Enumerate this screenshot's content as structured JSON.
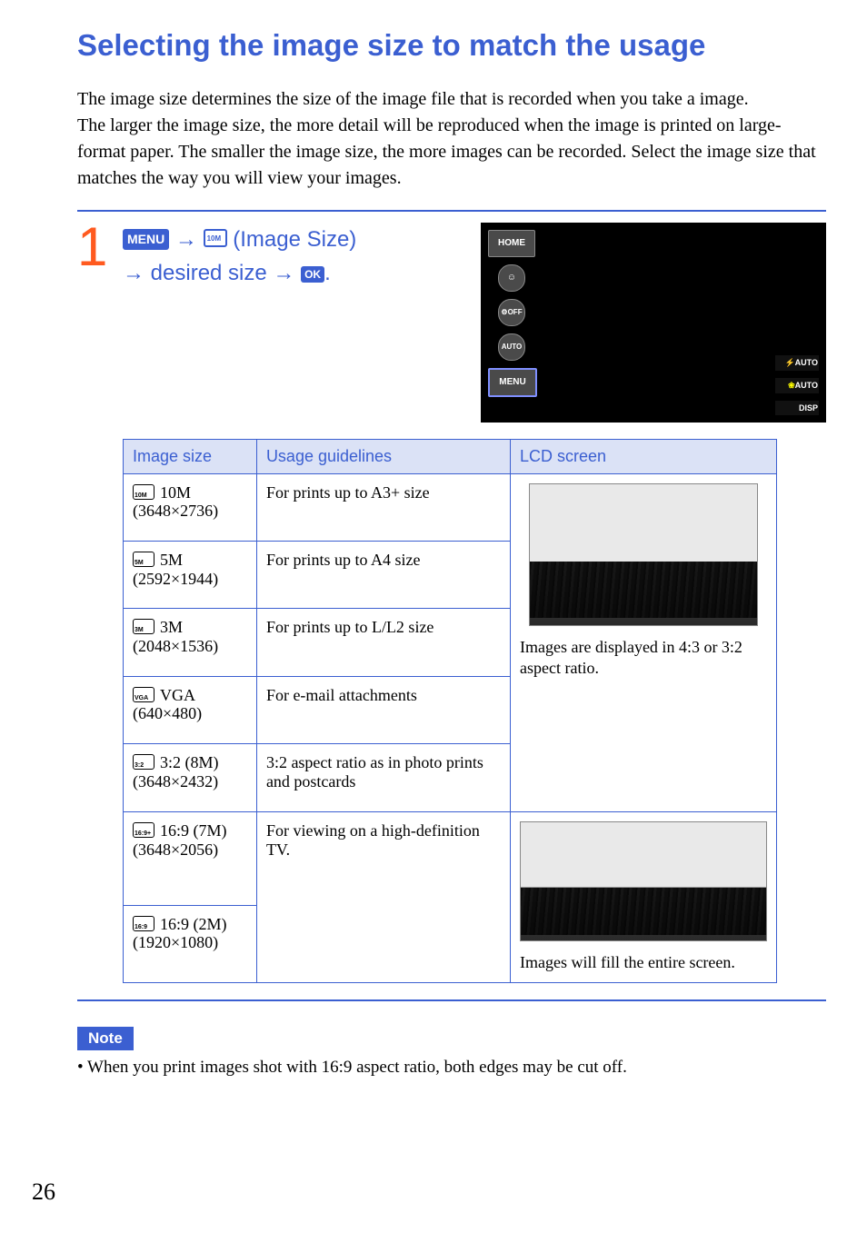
{
  "page": {
    "title": "Selecting the image size to match the usage",
    "intro": "The image size determines the size of the image file that is recorded when you take a image.\nThe larger the image size, the more detail will be reproduced when the image is printed on large-format paper. The smaller the image size, the more images can be recorded. Select the image size that matches the way you will view your images.",
    "page_number": "26"
  },
  "step": {
    "number": "1",
    "menu_label": "MENU",
    "image_size_label": "(Image Size)",
    "desired_label": "desired size",
    "ok_label": "OK",
    "period": "."
  },
  "camera": {
    "left": [
      "HOME",
      "☺",
      "⚙OFF",
      "AUTO",
      "MENU"
    ],
    "right": [
      {
        "lead": "⚡",
        "text": "AUTO"
      },
      {
        "lead": "❀",
        "text": "AUTO"
      },
      {
        "lead": "",
        "text": "DISP"
      }
    ]
  },
  "table": {
    "headers": {
      "c1": "Image size",
      "c2": "Usage guidelines",
      "c3": "LCD screen"
    },
    "rows": [
      {
        "name": "10M",
        "dims": "(3648×2736)",
        "usage": "For prints up to A3+ size"
      },
      {
        "name": "5M",
        "dims": "(2592×1944)",
        "usage": "For prints up to A4 size"
      },
      {
        "name": "3M",
        "dims": "(2048×1536)",
        "usage": "For prints up to L/L2 size"
      },
      {
        "name": "VGA",
        "dims": "(640×480)",
        "usage": "For e-mail attachments"
      },
      {
        "name": "3:2 (8M)",
        "dims": "(3648×2432)",
        "usage": "3:2 aspect ratio as in photo prints and postcards"
      },
      {
        "name": "16:9 (7M)",
        "dims": "(3648×2056)",
        "usage": "For viewing on a high-definition TV."
      },
      {
        "name": "16:9 (2M)",
        "dims": "(1920×1080)",
        "usage": ""
      }
    ],
    "lcd": {
      "caption43": "Images are displayed in 4:3 or 3:2 aspect ratio.",
      "caption169": "Images will fill the entire screen."
    }
  },
  "note": {
    "label": "Note",
    "text": "• When you print images shot with 16:9 aspect ratio, both edges may be cut off."
  }
}
